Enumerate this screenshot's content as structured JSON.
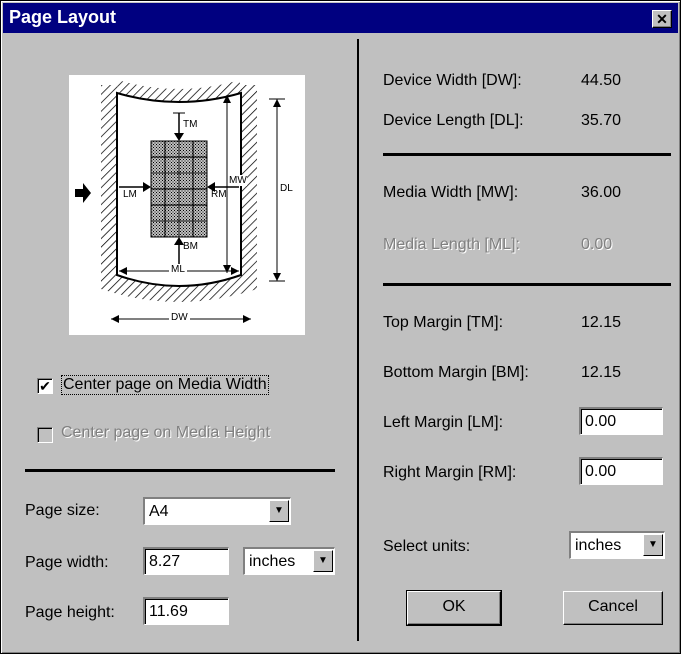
{
  "window": {
    "title": "Page Layout",
    "close_glyph": "✕"
  },
  "diagram": {
    "labels": {
      "tm": "TM",
      "bm": "BM",
      "lm": "LM",
      "rm": "RM",
      "mw": "MW",
      "dl": "DL",
      "ml": "ML",
      "dw": "DW"
    }
  },
  "options": {
    "center_width": {
      "label": "Center page on Media Width",
      "checked": true,
      "enabled": true
    },
    "center_height": {
      "label": "Center page on Media Height",
      "checked": false,
      "enabled": false
    }
  },
  "page": {
    "size_label": "Page size:",
    "size_value": "A4",
    "width_label": "Page width:",
    "width_value": "8.27",
    "width_units": "inches",
    "height_label": "Page height:",
    "height_value": "11.69"
  },
  "device": {
    "width_label": "Device Width [DW]:",
    "width_value": "44.50",
    "length_label": "Device Length [DL]:",
    "length_value": "35.70"
  },
  "media": {
    "width_label": "Media Width [MW]:",
    "width_value": "36.00",
    "length_label": "Media Length [ML]:",
    "length_value": "0.00"
  },
  "margins": {
    "top_label": "Top Margin [TM]:",
    "top_value": "12.15",
    "bottom_label": "Bottom Margin [BM]:",
    "bottom_value": "12.15",
    "left_label": "Left Margin [LM]:",
    "left_value": "0.00",
    "right_label": "Right Margin [RM]:",
    "right_value": "0.00"
  },
  "units": {
    "label": "Select units:",
    "value": "inches"
  },
  "buttons": {
    "ok": "OK",
    "cancel": "Cancel"
  }
}
